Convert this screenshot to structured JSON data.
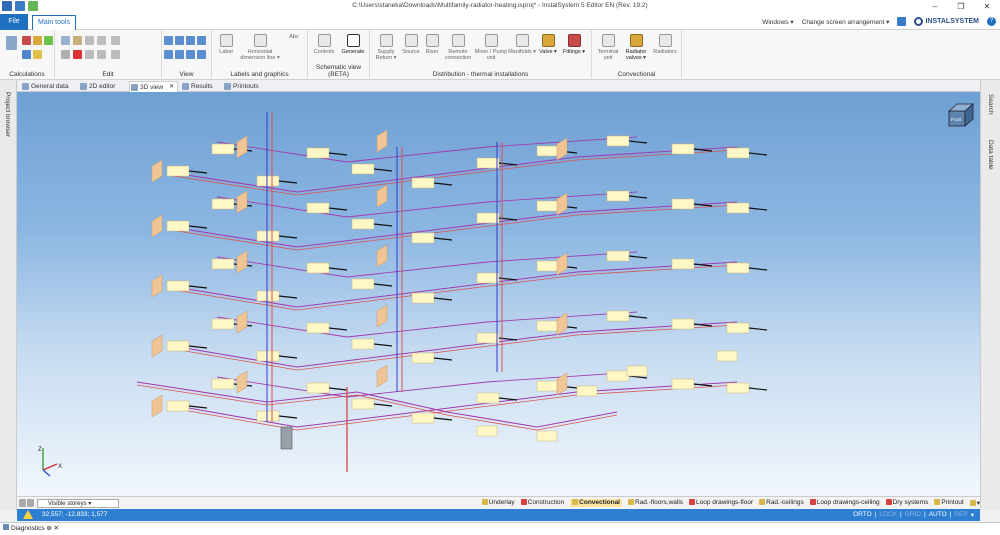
{
  "window": {
    "title": "C:\\Users\\staneka\\Downloads\\Multifamily-radiator-heating.isproj* - InstalSystem 5 Editor EN (Rev. 19.2)"
  },
  "tabs": {
    "file": "File",
    "main": "Main tools"
  },
  "topright": {
    "windows": "Windows ▾",
    "arrangement": "Change screen arrangement ▾",
    "brand": "INSTALSYSTEM"
  },
  "ribbon": {
    "groups": [
      "Calculations",
      "Edit",
      "View",
      "Labels and graphics",
      "Schematic view (BETA)",
      "Distribution - thermal installations",
      "Convectional"
    ],
    "labels_graphics": {
      "label": "Label",
      "dimension": "Horizontal dimension line ▾",
      "abc": "Abc"
    },
    "schematic": {
      "controls": "Controls",
      "generate": "Generate"
    },
    "distribution": {
      "supply": "Supply Return ▾",
      "source": "Source",
      "riser": "Riser",
      "remote": "Remote connection",
      "mixer": "Mixer / Pump unit",
      "manifolds": "Manifolds ▾",
      "valve": "Valve ▾",
      "fittings": "Fittings ▾"
    },
    "convectional": {
      "terminal": "Terminal unit",
      "radiator_valves": "Radiator valves ▾",
      "radiators": "Radiators"
    }
  },
  "doc_tabs": [
    "General data",
    "2D editor",
    "3D view",
    "Results",
    "Printouts"
  ],
  "sidebars": {
    "left": "Project browser",
    "right1": "Search",
    "right2": "Data table"
  },
  "viewport": {
    "cube_label": "Front"
  },
  "bottom": {
    "visible_storeys": "Visible storeys",
    "layers": [
      "Underlay",
      "Construction",
      "Convectional",
      "Rad.-floors,walls",
      "Loop drawings-floor",
      "Rad.-ceilings",
      "Loop drawings-ceiling",
      "Dry systems",
      "Printout"
    ]
  },
  "status": {
    "coords": "32,557; -12,833; 1,577",
    "modes": [
      "ORTO",
      "LOCK",
      "GRID",
      "AUTO",
      "REP"
    ]
  },
  "diagnostics": "Diagnostics"
}
